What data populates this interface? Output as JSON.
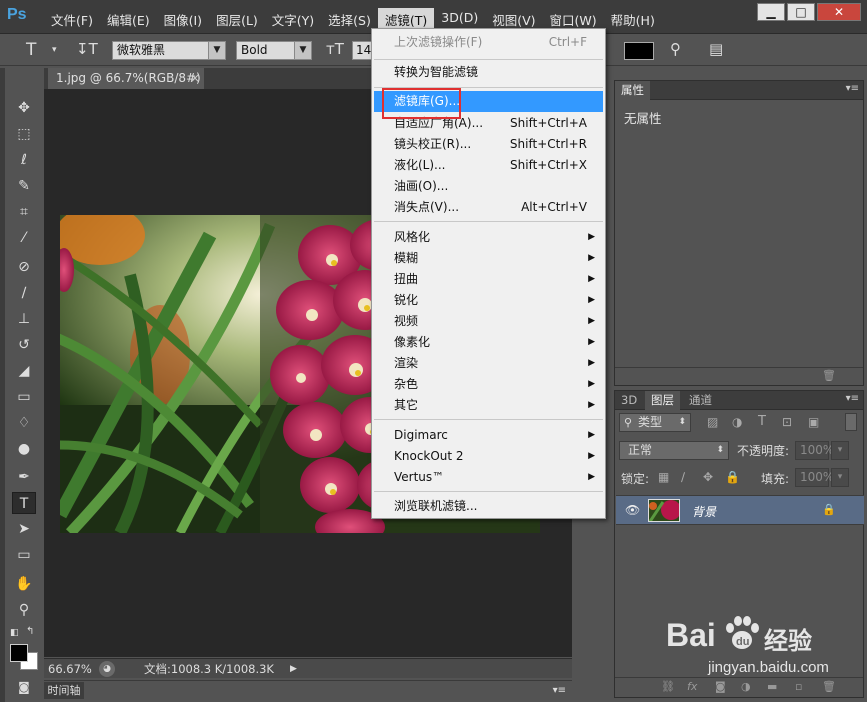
{
  "app": {
    "logo": "Ps"
  },
  "menubar": {
    "items": [
      "文件(F)",
      "编辑(E)",
      "图像(I)",
      "图层(L)",
      "文字(Y)",
      "选择(S)",
      "滤镜(T)",
      "3D(D)",
      "视图(V)",
      "窗口(W)",
      "帮助(H)"
    ],
    "active": "滤镜(T)"
  },
  "window_controls": {
    "minimize": "▁",
    "maximize": "□",
    "close": "✕"
  },
  "options": {
    "font_family": "微软雅黑",
    "font_style": "Bold",
    "font_size": "14"
  },
  "document": {
    "tab_title": "1.jpg @ 66.7%(RGB/8#)",
    "tab_close": "×",
    "zoom": "66.67%",
    "doc_info": "文档:1008.3 K/1008.3K"
  },
  "timeline": {
    "label": "时间轴"
  },
  "properties_panel": {
    "tab": "属性",
    "content": "无属性"
  },
  "layers_panel": {
    "tabs": [
      "3D",
      "图层",
      "通道"
    ],
    "filter_kind": "类型",
    "blend_mode": "正常",
    "opacity_label": "不透明度:",
    "opacity_value": "100%",
    "lock_label": "锁定:",
    "fill_label": "填充:",
    "fill_value": "100%",
    "layer_name": "背景"
  },
  "filter_menu": {
    "items": [
      {
        "label": "上次滤镜操作(F)",
        "shortcut": "Ctrl+F",
        "disabled": true
      },
      {
        "label": "转换为智能滤镜"
      },
      {
        "label": "滤镜库(G)...",
        "highlighted": true
      },
      {
        "label": "自适应广角(A)...",
        "shortcut": "Shift+Ctrl+A"
      },
      {
        "label": "镜头校正(R)...",
        "shortcut": "Shift+Ctrl+R"
      },
      {
        "label": "液化(L)...",
        "shortcut": "Shift+Ctrl+X"
      },
      {
        "label": "油画(O)..."
      },
      {
        "label": "消失点(V)...",
        "shortcut": "Alt+Ctrl+V"
      },
      {
        "label": "风格化",
        "submenu": true
      },
      {
        "label": "模糊",
        "submenu": true
      },
      {
        "label": "扭曲",
        "submenu": true
      },
      {
        "label": "锐化",
        "submenu": true
      },
      {
        "label": "视频",
        "submenu": true
      },
      {
        "label": "像素化",
        "submenu": true
      },
      {
        "label": "渲染",
        "submenu": true
      },
      {
        "label": "杂色",
        "submenu": true
      },
      {
        "label": "其它",
        "submenu": true
      },
      {
        "label": "Digimarc",
        "submenu": true
      },
      {
        "label": "KnockOut 2",
        "submenu": true
      },
      {
        "label": "Vertus™",
        "submenu": true
      },
      {
        "label": "浏览联机滤镜..."
      }
    ]
  },
  "watermark": {
    "brand": "Bai",
    "brand2": "du",
    "cn": "经验",
    "url": "jingyan.baidu.com"
  },
  "colors": {
    "menu_highlight": "#3399ff",
    "annotation_box": "#e03030",
    "layer_selected": "#596b86"
  }
}
